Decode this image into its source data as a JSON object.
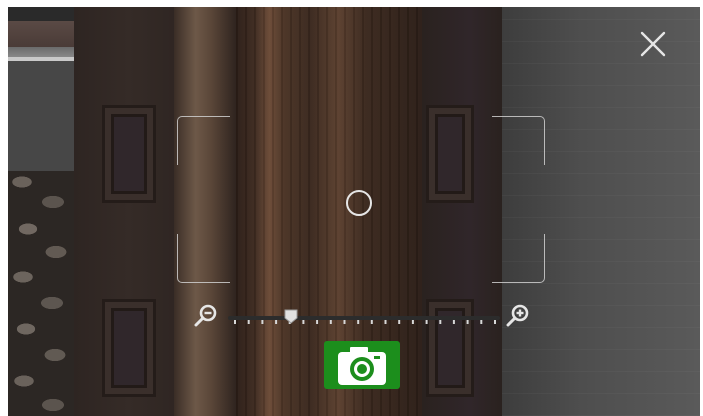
{
  "scene": {
    "description_icons": [
      "close-icon",
      "zoom-out-icon",
      "zoom-in-icon",
      "camera-icon",
      "target-circle"
    ]
  },
  "zoom": {
    "level": 0.23,
    "tick_count": 20
  },
  "colors": {
    "capture_button": "#1c8e1c",
    "ui_light": "#e6e6e6"
  }
}
